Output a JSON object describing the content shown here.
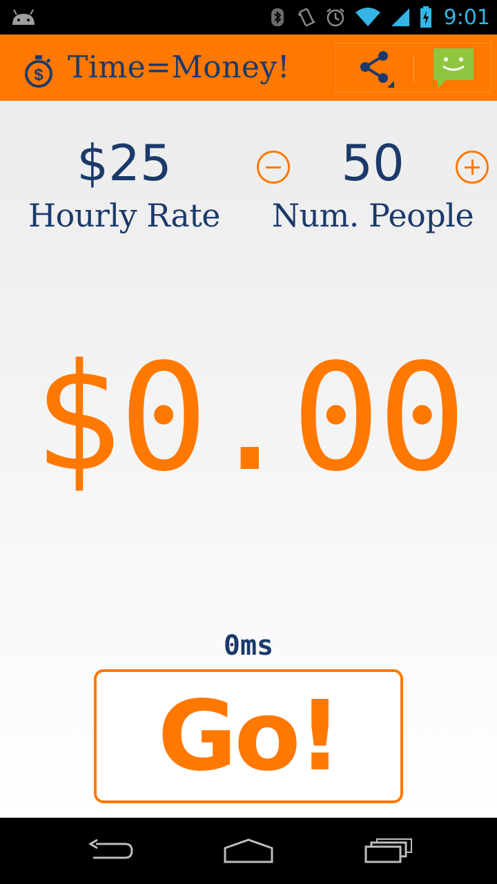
{
  "status_bar": {
    "time": "9:01",
    "icons": [
      "android-debug-icon",
      "bluetooth-icon",
      "vibrate-icon",
      "alarm-icon",
      "wifi-icon",
      "signal-icon",
      "battery-charging-icon"
    ],
    "time_color": "#33b5e5"
  },
  "action_bar": {
    "title": "Time=Money!",
    "app_icon": "stopwatch-dollar-icon",
    "actions": [
      "share-icon",
      "sms-icon"
    ],
    "background": "#ff7800",
    "title_color": "#1b3a6b"
  },
  "main": {
    "hourly_rate": {
      "value": "$25",
      "label": "Hourly Rate"
    },
    "num_people": {
      "value": "50",
      "label": "Num. People"
    },
    "total": "$0.00",
    "elapsed": "0ms",
    "go_label": "Go!",
    "accent_color": "#ff7800",
    "text_color": "#1b3a6b"
  },
  "nav_bar": {
    "buttons": [
      "back-icon",
      "home-icon",
      "recent-apps-icon"
    ]
  }
}
